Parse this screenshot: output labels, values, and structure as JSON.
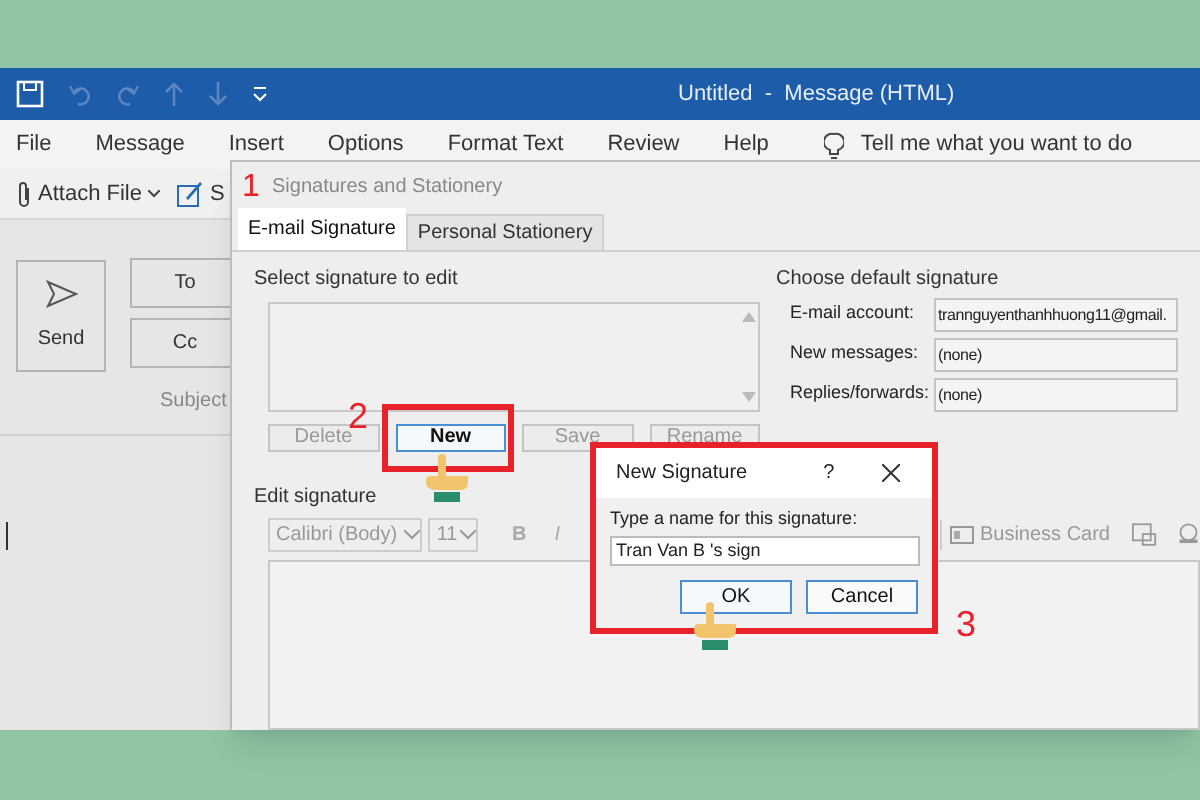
{
  "window": {
    "title": "Untitled  -  Message (HTML)"
  },
  "menu": [
    {
      "label": "File"
    },
    {
      "label": "Message"
    },
    {
      "label": "Insert"
    },
    {
      "label": "Options"
    },
    {
      "label": "Format Text"
    },
    {
      "label": "Review"
    },
    {
      "label": "Help"
    }
  ],
  "tell_me": "Tell me what you want to do",
  "toolbar": [
    {
      "label": "Attach File",
      "kind": "attach"
    },
    {
      "label": "S",
      "kind": "signature"
    }
  ],
  "compose": {
    "send": "Send",
    "to": "To",
    "cc": "Cc",
    "subject": "Subject"
  },
  "dialog": {
    "title": "Signatures and Stationery",
    "tabs": [
      {
        "label": "E-mail Signature",
        "selected": true
      },
      {
        "label": "Personal Stationery",
        "selected": false
      }
    ],
    "select_heading": "Select signature to edit",
    "buttons": [
      {
        "label": "Delete",
        "disabled": true
      },
      {
        "label": "New",
        "disabled": false
      },
      {
        "label": "Save",
        "disabled": true
      },
      {
        "label": "Rename",
        "disabled": true
      }
    ],
    "default_heading": "Choose default signature",
    "fields": [
      {
        "label": "E-mail account:",
        "value": "trannguyenthanhhuong11@gmail."
      },
      {
        "label": "New messages:",
        "value": "(none)"
      },
      {
        "label": "Replies/forwards:",
        "value": "(none)"
      }
    ],
    "edit_heading": "Edit signature",
    "font": "Calibri (Body)",
    "size": "11",
    "format_buttons": [
      "B",
      "I"
    ],
    "business_card": "Business Card"
  },
  "new_signature": {
    "title": "New Signature",
    "help": "?",
    "prompt": "Type a name for this signature:",
    "value": "Tran Van B 's sign",
    "buttons": [
      "OK",
      "Cancel"
    ]
  },
  "annotations": [
    "1",
    "2",
    "3"
  ]
}
